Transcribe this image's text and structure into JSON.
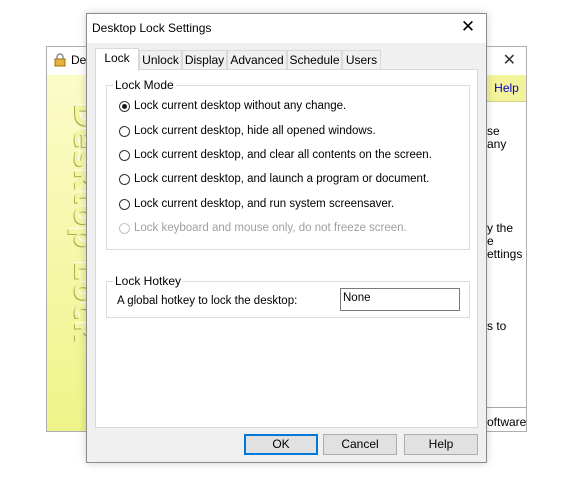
{
  "background_window": {
    "title": "Des",
    "banner_text": "Desktop Lock",
    "help_label": "Help",
    "right_snippets": [
      "se",
      "any",
      "y the",
      "e",
      "ettings",
      "s to",
      "oftware"
    ]
  },
  "dialog": {
    "title": "Desktop Lock Settings",
    "close_glyph": "✕",
    "tabs": [
      "Lock",
      "Unlock",
      "Display",
      "Advanced",
      "Schedule",
      "Users"
    ],
    "active_tab": "Lock",
    "lock_mode": {
      "label": "Lock Mode",
      "options": [
        {
          "label": "Lock current desktop without any change.",
          "checked": true,
          "disabled": false
        },
        {
          "label": "Lock current desktop, hide all opened windows.",
          "checked": false,
          "disabled": false
        },
        {
          "label": "Lock current desktop, and clear all contents on the screen.",
          "checked": false,
          "disabled": false
        },
        {
          "label": "Lock current desktop, and launch a program or document.",
          "checked": false,
          "disabled": false
        },
        {
          "label": "Lock current desktop, and run system screensaver.",
          "checked": false,
          "disabled": false
        },
        {
          "label": "Lock keyboard and mouse only, do not freeze screen.",
          "checked": false,
          "disabled": true
        }
      ]
    },
    "lock_hotkey": {
      "label": "Lock Hotkey",
      "description": "A global hotkey to lock the desktop:",
      "value": "None"
    },
    "buttons": {
      "ok": "OK",
      "cancel": "Cancel",
      "help": "Help"
    }
  },
  "colors": {
    "banner_top": "#fbfbc9",
    "banner_bottom": "#eff489",
    "default_button_border": "#0078d7"
  }
}
